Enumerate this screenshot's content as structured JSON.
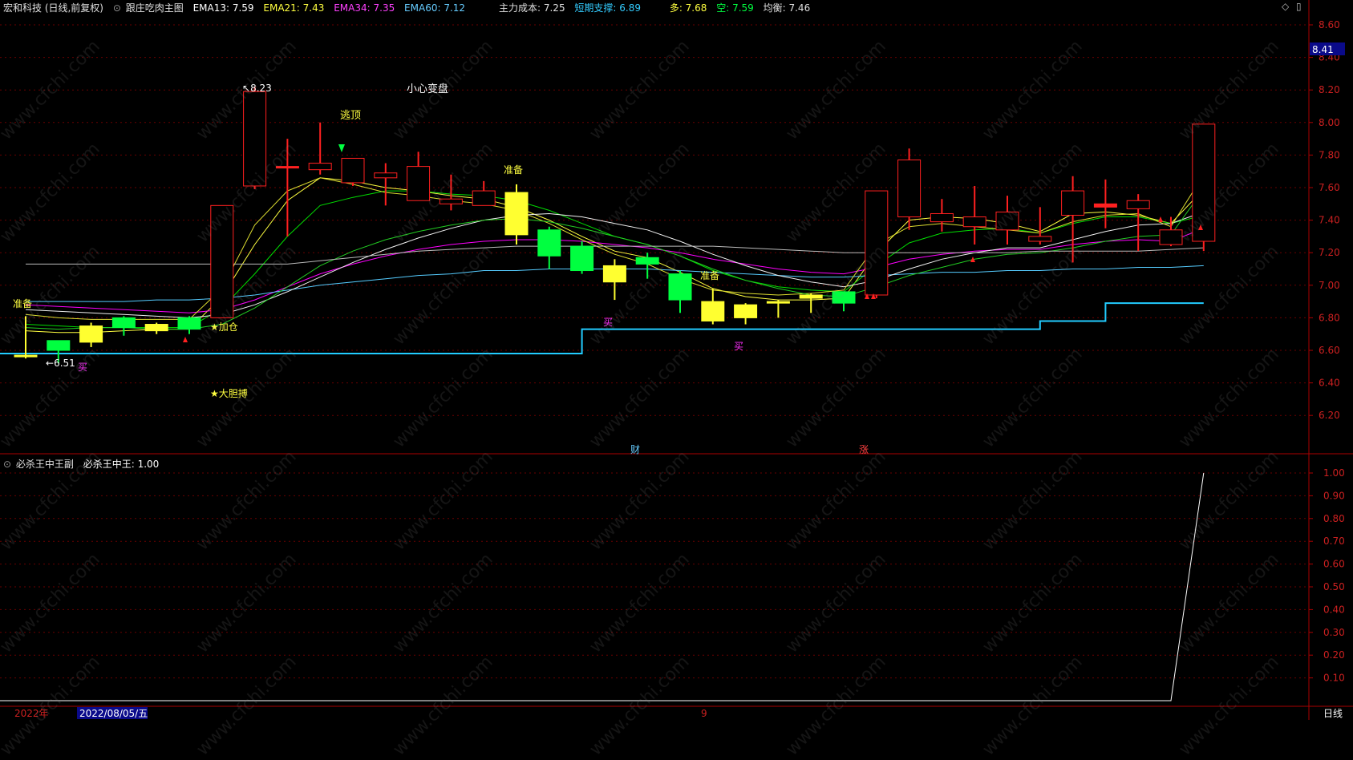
{
  "main_header": {
    "stock_name": "宏和科技 (日线,前复权)",
    "indicator_name": "跟庄吃肉主图",
    "ema13": "EMA13: 7.59",
    "ema21": "EMA21: 7.43",
    "ema34": "EMA34: 7.35",
    "ema60": "EMA60: 7.12",
    "main_cost": "主力成本: 7.25",
    "short_support": "短期支撑: 6.89",
    "long": "多: 7.68",
    "short": "空: 7.59",
    "balance": "均衡: 7.46"
  },
  "sub_header": {
    "title": "必杀王中王副",
    "value": "必杀王中王: 1.00"
  },
  "price_axis": {
    "ticks": [
      "8.60",
      "8.40",
      "8.20",
      "8.00",
      "7.80",
      "7.60",
      "7.40",
      "7.20",
      "7.00",
      "6.80",
      "6.60",
      "6.40",
      "6.20"
    ],
    "current_price": "8.41"
  },
  "sub_axis": {
    "ticks": [
      "1.00",
      "0.90",
      "0.80",
      "0.70",
      "0.60",
      "0.50",
      "0.40",
      "0.30",
      "0.20",
      "0.10"
    ]
  },
  "annotations": {
    "high_mark": "8.23",
    "low_mark": "6.51",
    "careful": "小心变盘",
    "escape_top": "逃顶",
    "prepare_1": "准备",
    "prepare_2": "准备",
    "prepare_3": "准备",
    "add_position": "★加仓",
    "bold_fight": "★大胆搏",
    "buy_1": "买",
    "buy_2": "买",
    "buy_3": "买",
    "finance": "财",
    "rise": "涨"
  },
  "bottom_bar": {
    "year": "2022年",
    "date": "2022/08/05/五",
    "month_marker": "9",
    "period": "日线"
  },
  "watermark": "www.cfchi.com",
  "colors": {
    "up": "#ff2020",
    "down": "#00ff40",
    "yellow": "#ffff30",
    "ema13": "#ffff40",
    "ema21": "#00dd00",
    "ema34": "#ff00ff",
    "ema60": "#55ccff",
    "support": "#22ccff",
    "axis_red": "#aa0000"
  },
  "chart_data": {
    "type": "candlestick",
    "candles": [
      {
        "o": 6.57,
        "c": 6.57,
        "h": 6.81,
        "l": 6.55,
        "color": "yellow"
      },
      {
        "o": 6.66,
        "c": 6.6,
        "h": 6.66,
        "l": 6.52,
        "color": "down"
      },
      {
        "o": 6.75,
        "c": 6.65,
        "h": 6.77,
        "l": 6.62,
        "color": "yellow"
      },
      {
        "o": 6.8,
        "c": 6.74,
        "h": 6.81,
        "l": 6.69,
        "color": "down"
      },
      {
        "o": 6.76,
        "c": 6.72,
        "h": 6.77,
        "l": 6.7,
        "color": "yellow"
      },
      {
        "o": 6.8,
        "c": 6.73,
        "h": 6.81,
        "l": 6.7,
        "color": "down"
      },
      {
        "o": 6.8,
        "c": 7.49,
        "h": 7.49,
        "l": 6.8,
        "color": "up"
      },
      {
        "o": 7.61,
        "c": 8.19,
        "h": 8.22,
        "l": 7.59,
        "color": "up"
      },
      {
        "o": 7.73,
        "c": 7.73,
        "h": 7.9,
        "l": 7.3,
        "color": "up"
      },
      {
        "o": 7.71,
        "c": 7.75,
        "h": 8.0,
        "l": 7.68,
        "color": "up"
      },
      {
        "o": 7.63,
        "c": 7.78,
        "h": 7.78,
        "l": 7.61,
        "color": "up"
      },
      {
        "o": 7.66,
        "c": 7.69,
        "h": 7.75,
        "l": 7.49,
        "color": "up"
      },
      {
        "o": 7.52,
        "c": 7.73,
        "h": 7.82,
        "l": 7.52,
        "color": "up"
      },
      {
        "o": 7.5,
        "c": 7.53,
        "h": 7.68,
        "l": 7.46,
        "color": "up"
      },
      {
        "o": 7.49,
        "c": 7.58,
        "h": 7.64,
        "l": 7.49,
        "color": "up"
      },
      {
        "o": 7.31,
        "c": 7.57,
        "h": 7.62,
        "l": 7.25,
        "color": "yellow"
      },
      {
        "o": 7.34,
        "c": 7.18,
        "h": 7.36,
        "l": 7.1,
        "color": "down"
      },
      {
        "o": 7.24,
        "c": 7.09,
        "h": 7.27,
        "l": 7.07,
        "color": "down"
      },
      {
        "o": 7.12,
        "c": 7.02,
        "h": 7.16,
        "l": 6.91,
        "color": "yellow"
      },
      {
        "o": 7.17,
        "c": 7.13,
        "h": 7.2,
        "l": 7.04,
        "color": "down"
      },
      {
        "o": 7.07,
        "c": 6.91,
        "h": 7.09,
        "l": 6.83,
        "color": "down"
      },
      {
        "o": 6.9,
        "c": 6.78,
        "h": 6.98,
        "l": 6.76,
        "color": "yellow"
      },
      {
        "o": 6.88,
        "c": 6.8,
        "h": 6.89,
        "l": 6.76,
        "color": "yellow"
      },
      {
        "o": 6.9,
        "c": 6.89,
        "h": 6.91,
        "l": 6.8,
        "color": "yellow"
      },
      {
        "o": 6.94,
        "c": 6.92,
        "h": 6.95,
        "l": 6.83,
        "color": "yellow"
      },
      {
        "o": 6.96,
        "c": 6.89,
        "h": 6.96,
        "l": 6.84,
        "color": "down"
      },
      {
        "o": 6.94,
        "c": 7.58,
        "h": 7.58,
        "l": 6.92,
        "color": "up"
      },
      {
        "o": 7.42,
        "c": 7.77,
        "h": 7.84,
        "l": 7.34,
        "color": "up"
      },
      {
        "o": 7.39,
        "c": 7.44,
        "h": 7.53,
        "l": 7.33,
        "color": "up"
      },
      {
        "o": 7.36,
        "c": 7.42,
        "h": 7.61,
        "l": 7.25,
        "color": "up"
      },
      {
        "o": 7.34,
        "c": 7.45,
        "h": 7.55,
        "l": 7.25,
        "color": "up"
      },
      {
        "o": 7.27,
        "c": 7.3,
        "h": 7.48,
        "l": 7.25,
        "color": "up"
      },
      {
        "o": 7.43,
        "c": 7.58,
        "h": 7.67,
        "l": 7.14,
        "color": "up"
      },
      {
        "o": 7.48,
        "c": 7.5,
        "h": 7.65,
        "l": 7.35,
        "color": "up"
      },
      {
        "o": 7.47,
        "c": 7.52,
        "h": 7.56,
        "l": 7.21,
        "color": "up"
      },
      {
        "o": 7.25,
        "c": 7.34,
        "h": 7.42,
        "l": 7.24,
        "color": "up"
      },
      {
        "o": 7.27,
        "c": 7.99,
        "h": 7.99,
        "l": 7.21,
        "color": "up"
      }
    ],
    "series": [
      {
        "name": "EMA13",
        "values": [
          6.72,
          6.71,
          6.71,
          6.72,
          6.73,
          6.73,
          6.93,
          7.25,
          7.52,
          7.66,
          7.64,
          7.6,
          7.58,
          7.55,
          7.53,
          7.48,
          7.4,
          7.3,
          7.21,
          7.17,
          7.08,
          6.98,
          6.93,
          6.91,
          6.91,
          6.92,
          7.2,
          7.4,
          7.42,
          7.41,
          7.38,
          7.33,
          7.44,
          7.45,
          7.43,
          7.38,
          7.59
        ]
      },
      {
        "name": "EMA21",
        "values": [
          6.76,
          6.75,
          6.74,
          6.74,
          6.74,
          6.74,
          6.86,
          7.07,
          7.3,
          7.49,
          7.54,
          7.58,
          7.58,
          7.56,
          7.55,
          7.52,
          7.46,
          7.38,
          7.3,
          7.25,
          7.18,
          7.09,
          7.03,
          6.99,
          6.97,
          6.96,
          7.12,
          7.26,
          7.32,
          7.34,
          7.35,
          7.32,
          7.38,
          7.42,
          7.42,
          7.38,
          7.43
        ]
      },
      {
        "name": "EMA34",
        "values": [
          6.88,
          6.87,
          6.86,
          6.85,
          6.84,
          6.83,
          6.85,
          6.91,
          6.99,
          7.07,
          7.13,
          7.18,
          7.22,
          7.25,
          7.27,
          7.28,
          7.28,
          7.27,
          7.25,
          7.23,
          7.2,
          7.16,
          7.13,
          7.1,
          7.08,
          7.07,
          7.11,
          7.16,
          7.19,
          7.21,
          7.22,
          7.22,
          7.25,
          7.27,
          7.28,
          7.27,
          7.35
        ]
      },
      {
        "name": "EMA60",
        "values": [
          6.9,
          6.9,
          6.9,
          6.9,
          6.91,
          6.91,
          6.92,
          6.94,
          6.97,
          7.0,
          7.02,
          7.04,
          7.06,
          7.07,
          7.09,
          7.09,
          7.1,
          7.1,
          7.1,
          7.1,
          7.09,
          7.08,
          7.07,
          7.06,
          7.05,
          7.05,
          7.06,
          7.07,
          7.08,
          7.08,
          7.09,
          7.09,
          7.1,
          7.1,
          7.11,
          7.11,
          7.12
        ]
      },
      {
        "name": "主力成本",
        "values": [
          6.85,
          6.84,
          6.83,
          6.82,
          6.81,
          6.8,
          6.82,
          6.88,
          6.96,
          7.05,
          7.14,
          7.22,
          7.29,
          7.35,
          7.4,
          7.43,
          7.44,
          7.42,
          7.38,
          7.34,
          7.27,
          7.19,
          7.12,
          7.06,
          7.02,
          6.99,
          7.03,
          7.1,
          7.16,
          7.2,
          7.23,
          7.23,
          7.28,
          7.33,
          7.37,
          7.38,
          7.45
        ]
      },
      {
        "name": "多",
        "values": [
          6.82,
          6.8,
          6.79,
          6.79,
          6.79,
          6.79,
          6.98,
          7.37,
          7.58,
          7.66,
          7.62,
          7.57,
          7.55,
          7.52,
          7.5,
          7.46,
          7.38,
          7.28,
          7.19,
          7.13,
          7.04,
          6.97,
          6.95,
          6.94,
          6.95,
          6.97,
          7.25,
          7.36,
          7.38,
          7.36,
          7.34,
          7.32,
          7.39,
          7.43,
          7.44,
          7.36,
          7.68
        ]
      },
      {
        "name": "空",
        "values": [
          6.74,
          6.73,
          6.74,
          6.74,
          6.73,
          6.73,
          6.76,
          6.86,
          6.99,
          7.12,
          7.21,
          7.28,
          7.33,
          7.37,
          7.4,
          7.41,
          7.39,
          7.35,
          7.3,
          7.25,
          7.18,
          7.1,
          7.03,
          6.98,
          6.94,
          6.93,
          6.99,
          7.06,
          7.11,
          7.16,
          7.19,
          7.2,
          7.23,
          7.27,
          7.3,
          7.31,
          7.59
        ]
      },
      {
        "name": "均衡",
        "values": [
          7.13,
          7.13,
          7.13,
          7.13,
          7.13,
          7.13,
          7.13,
          7.13,
          7.13,
          7.15,
          7.17,
          7.19,
          7.21,
          7.22,
          7.23,
          7.24,
          7.24,
          7.24,
          7.24,
          7.24,
          7.24,
          7.24,
          7.23,
          7.22,
          7.21,
          7.2,
          7.2,
          7.2,
          7.2,
          7.2,
          7.2,
          7.21,
          7.21,
          7.21,
          7.21,
          7.22,
          7.23
        ]
      }
    ],
    "support_steps": [
      {
        "from": 0,
        "to": 17,
        "value": 6.58
      },
      {
        "from": 17,
        "to": 31,
        "value": 6.73
      },
      {
        "from": 31,
        "to": 33,
        "value": 6.78
      },
      {
        "from": 33,
        "to": 36,
        "value": 6.89
      }
    ],
    "sub_line": [
      0,
      0,
      0,
      0,
      0,
      0,
      0,
      0,
      0,
      0,
      0,
      0,
      0,
      0,
      0,
      0,
      0,
      0,
      0,
      0,
      0,
      0,
      0,
      0,
      0,
      0,
      0,
      0,
      0,
      0,
      0,
      0,
      0,
      0,
      0,
      0,
      1.0
    ],
    "ylim": [
      6.0,
      8.6
    ],
    "sub_ylim": [
      0,
      1.05
    ]
  }
}
